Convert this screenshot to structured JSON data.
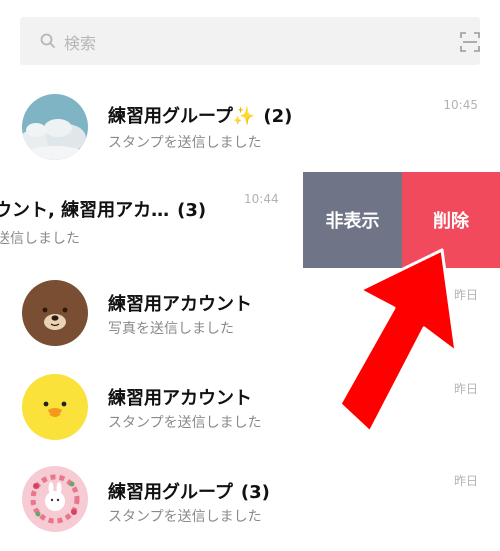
{
  "search": {
    "placeholder": "検索",
    "search_icon": "search-icon",
    "scan_icon": "qr-scan-icon"
  },
  "chats": [
    {
      "name": "練習用グループ✨",
      "count": "(2)",
      "preview": "スタンプを送信しました",
      "time": "10:45",
      "avatar": "sky-clouds-photo"
    },
    {
      "name": "ウント, 練習用アカ…",
      "count": "(3)",
      "preview": "送信しました",
      "time": "10:44",
      "avatar": "none"
    },
    {
      "name": "練習用アカウント",
      "count": "",
      "preview": "写真を送信しました",
      "time": "昨日",
      "avatar": "brown-bear"
    },
    {
      "name": "練習用アカウント",
      "count": "",
      "preview": "スタンプを送信しました",
      "time": "昨日",
      "avatar": "sally-chick"
    },
    {
      "name": "練習用グループ",
      "count": "(3)",
      "preview": "スタンプを送信しました",
      "time": "昨日",
      "avatar": "cony-flower-wreath"
    }
  ],
  "actions": {
    "hide_label": "非表示",
    "delete_label": "削除"
  },
  "colors": {
    "hide_bg": "#6f7587",
    "delete_bg": "#f24a5d",
    "arrow": "#ff0000"
  }
}
